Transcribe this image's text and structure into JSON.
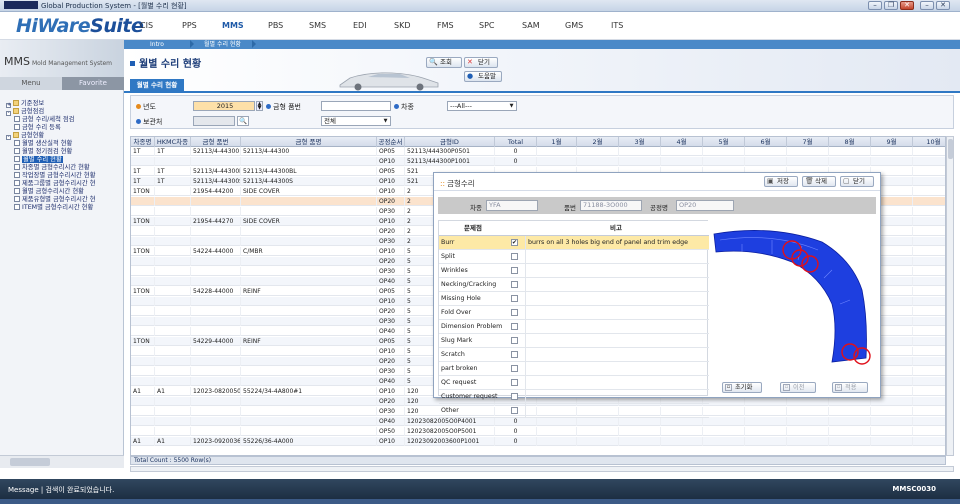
{
  "window": {
    "title": "Global Production System - [월별 수리 현황]"
  },
  "app": {
    "logo_main": "HiWare",
    "logo_suite": "Suite"
  },
  "menu": [
    "CIS",
    "PPS",
    "MMS",
    "PBS",
    "SMS",
    "EDI",
    "SKD",
    "FMS",
    "SPC",
    "SAM",
    "GMS",
    "ITS"
  ],
  "menu_active": "MMS",
  "breadcrumb": {
    "intro": "Intro",
    "current": "월별 수리 현황"
  },
  "left": {
    "system": "MMS",
    "system_sub": "Mold Management System",
    "tab_menu": "Menu",
    "tab_favorite": "Favorite",
    "tree": [
      {
        "label": "기준정보",
        "level": 0,
        "type": "folder",
        "toggle": "+"
      },
      {
        "label": "금형점검",
        "level": 0,
        "type": "folder",
        "toggle": "-"
      },
      {
        "label": "금형 수리/세척 점검",
        "level": 1,
        "type": "doc"
      },
      {
        "label": "금형 수리 등록",
        "level": 1,
        "type": "doc"
      },
      {
        "label": "금형현황",
        "level": 0,
        "type": "folder",
        "toggle": "-"
      },
      {
        "label": "월별 생산실적 현황",
        "level": 1,
        "type": "doc"
      },
      {
        "label": "월별 정기점검 현황",
        "level": 1,
        "type": "doc"
      },
      {
        "label": "월별 수리 현황",
        "level": 1,
        "type": "doc",
        "selected": true
      },
      {
        "label": "차종별 금형수리시간 현황",
        "level": 1,
        "type": "doc"
      },
      {
        "label": "작업장별 금형수리시간 현황",
        "level": 1,
        "type": "doc"
      },
      {
        "label": "제품그룹별 금형수리시간 현",
        "level": 1,
        "type": "doc"
      },
      {
        "label": "월별 금형수리시간 현황",
        "level": 1,
        "type": "doc"
      },
      {
        "label": "제품유형별 금형수리시간 현",
        "level": 1,
        "type": "doc"
      },
      {
        "label": "ITEM별 금형수리시간 현황",
        "level": 1,
        "type": "doc"
      }
    ]
  },
  "page": {
    "title": "월별 수리 현황",
    "tab": "월별 수리 현황",
    "btn_search": "조회",
    "btn_close": "닫기",
    "btn_help": "도움말",
    "key_search": "F1",
    "key_close": "F9",
    "key_help": "F1"
  },
  "filter": {
    "year_label": "년도",
    "year_value": "2015",
    "mold_no_label": "금형 품번",
    "mold_no_value": "",
    "car_label": "차종",
    "car_value": "---All---",
    "keeper_label": "보관처",
    "keeper_value": "",
    "status_value": "전체"
  },
  "grid": {
    "headers": [
      "차종명",
      "HKMC차종",
      "금형 품번",
      "금형 품명",
      "공정순서",
      "금형ID",
      "Total",
      "1월",
      "2월",
      "3월",
      "4월",
      "5월",
      "6월",
      "7월",
      "8월",
      "9월",
      "10월"
    ],
    "rows": [
      [
        "1T",
        "1T",
        "52113/4-44300",
        "52113/4-44300",
        "OP05",
        "52113/444300P0501",
        "0"
      ],
      [
        "",
        "",
        "",
        "",
        "OP10",
        "52113/444300P1001",
        "0"
      ],
      [
        "1T",
        "1T",
        "52113/4-44300BL",
        "52113/4-44300BL",
        "OP05",
        "521",
        ""
      ],
      [
        "1T",
        "1T",
        "52113/4-44300S",
        "52113/4-44300S",
        "OP10",
        "521",
        ""
      ],
      [
        "1TON",
        "",
        "21954-44200",
        "SIDE COVER",
        "OP10",
        "2",
        ""
      ],
      [
        "",
        "",
        "",
        "",
        "OP20",
        "2",
        ""
      ],
      [
        "",
        "",
        "",
        "",
        "OP30",
        "2",
        ""
      ],
      [
        "1TON",
        "",
        "21954-44270",
        "SIDE COVER",
        "OP10",
        "2",
        ""
      ],
      [
        "",
        "",
        "",
        "",
        "OP20",
        "2",
        ""
      ],
      [
        "",
        "",
        "",
        "",
        "OP30",
        "2",
        ""
      ],
      [
        "1TON",
        "",
        "54224-44000",
        "C/MBR",
        "OP10",
        "5",
        ""
      ],
      [
        "",
        "",
        "",
        "",
        "OP20",
        "5",
        ""
      ],
      [
        "",
        "",
        "",
        "",
        "OP30",
        "5",
        ""
      ],
      [
        "",
        "",
        "",
        "",
        "OP40",
        "5",
        ""
      ],
      [
        "1TON",
        "",
        "54228-44000",
        "REINF",
        "OP05",
        "5",
        ""
      ],
      [
        "",
        "",
        "",
        "",
        "OP10",
        "5",
        ""
      ],
      [
        "",
        "",
        "",
        "",
        "OP20",
        "5",
        ""
      ],
      [
        "",
        "",
        "",
        "",
        "OP30",
        "5",
        ""
      ],
      [
        "",
        "",
        "",
        "",
        "OP40",
        "5",
        ""
      ],
      [
        "1TON",
        "",
        "54229-44000",
        "REINF",
        "OP05",
        "5",
        ""
      ],
      [
        "",
        "",
        "",
        "",
        "OP10",
        "5",
        ""
      ],
      [
        "",
        "",
        "",
        "",
        "OP20",
        "5",
        ""
      ],
      [
        "",
        "",
        "",
        "",
        "OP30",
        "5",
        ""
      ],
      [
        "",
        "",
        "",
        "",
        "OP40",
        "5",
        ""
      ],
      [
        "A1",
        "A1",
        "12023-08200500",
        "55224/34-4A800#1",
        "OP10",
        "120",
        ""
      ],
      [
        "",
        "",
        "",
        "",
        "OP20",
        "120",
        ""
      ],
      [
        "",
        "",
        "",
        "",
        "OP30",
        "120",
        ""
      ],
      [
        "",
        "",
        "",
        "",
        "OP40",
        "12023082005O0P4001",
        "0"
      ],
      [
        "",
        "",
        "",
        "",
        "OP50",
        "12023082005O0P5001",
        "0"
      ],
      [
        "A1",
        "A1",
        "12023-09200360",
        "55226/36-4A000",
        "OP10",
        "12023092003600P1001",
        "0"
      ]
    ],
    "footer": "Total Count : 5500 Row(s)"
  },
  "popup": {
    "title": "금형수리",
    "btn_save": "저장",
    "btn_delete": "삭제",
    "btn_close": "닫기",
    "car_label": "차종",
    "car_value": "YFA",
    "part_label": "품번",
    "part_value": "71188-3O000",
    "process_label": "공정명",
    "process_value": "OP20",
    "col_problem": "문제점",
    "col_note": "비고",
    "items": [
      {
        "name": "Burr",
        "checked": true,
        "note": "burrs on all 3 holes big end of panel and trim edge"
      },
      {
        "name": "Split",
        "checked": false,
        "note": ""
      },
      {
        "name": "Wrinkles",
        "checked": false,
        "note": ""
      },
      {
        "name": "Necking/Cracking",
        "checked": false,
        "note": ""
      },
      {
        "name": "Missing Hole",
        "checked": false,
        "note": ""
      },
      {
        "name": "Fold Over",
        "checked": false,
        "note": ""
      },
      {
        "name": "Dimension Problem",
        "checked": false,
        "note": ""
      },
      {
        "name": "Slug Mark",
        "checked": false,
        "note": ""
      },
      {
        "name": "Scratch",
        "checked": false,
        "note": ""
      },
      {
        "name": "part broken",
        "checked": false,
        "note": ""
      },
      {
        "name": "QC request",
        "checked": false,
        "note": ""
      },
      {
        "name": "Customer request",
        "checked": false,
        "note": ""
      },
      {
        "name": "Other",
        "checked": false,
        "note": ""
      }
    ],
    "btn_reset": "초기화",
    "btn_prev": "이전",
    "btn_next": "적용"
  },
  "status": {
    "message": "Message | 검색이 완료되었습니다.",
    "code": "MMSC0030"
  },
  "colors": {
    "accent": "#2f78c4",
    "highlight_row": "#fbe3cd",
    "selected_item": "#fde9a6",
    "part_blue": "#1e3fe0",
    "circle_red": "#e0101a"
  }
}
